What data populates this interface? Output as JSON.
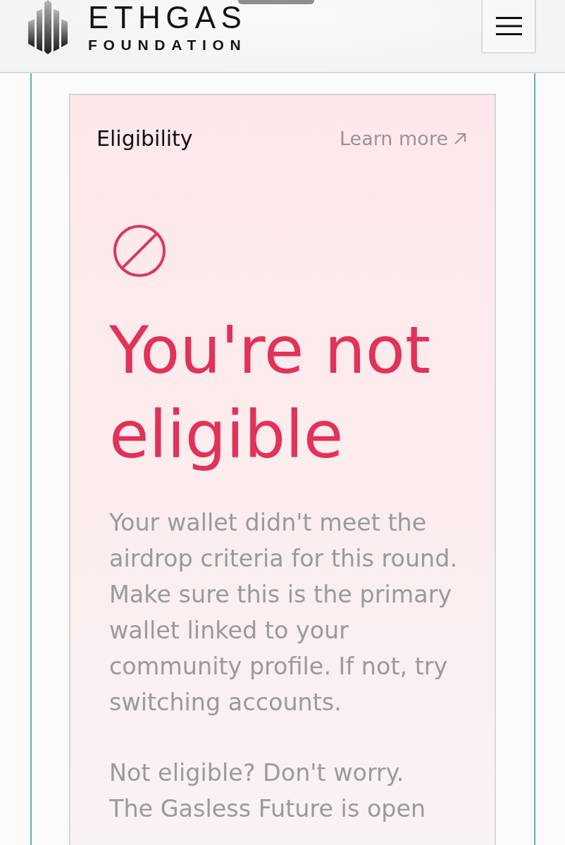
{
  "header": {
    "logo": {
      "title": "ETHGAS",
      "subtitle": "FOUNDATION"
    }
  },
  "card": {
    "title": "Eligibility",
    "link": "Learn more",
    "heading": "You're not eligible",
    "paragraphs": [
      "Your wallet didn't meet the airdrop criteria for this round. Make sure this is the primary wallet linked to your community profile. If not, try switching accounts.",
      "Not eligible? Don't worry.\nThe Gasless Future is open"
    ]
  }
}
